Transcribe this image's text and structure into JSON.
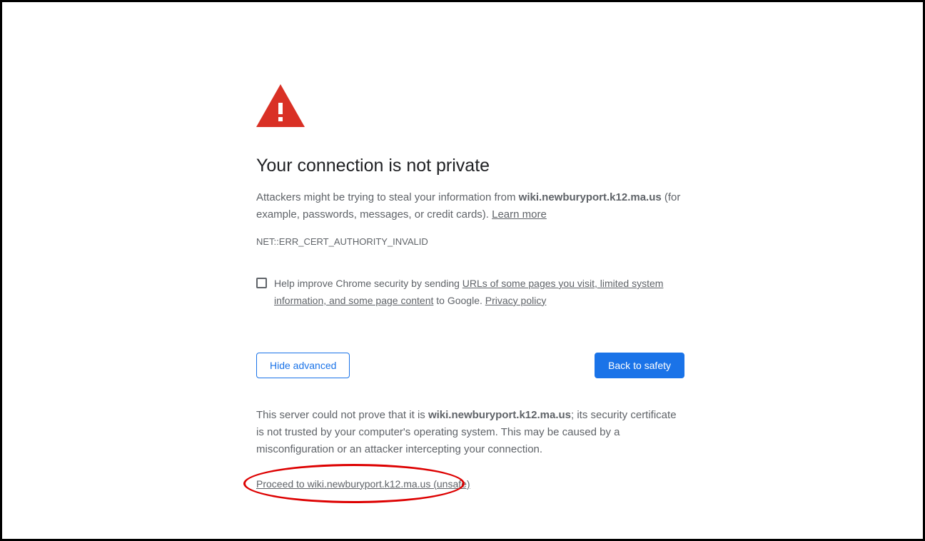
{
  "heading": "Your connection is not private",
  "description": {
    "prefix": "Attackers might be trying to steal your information from ",
    "host": "wiki.newburyport.k12.ma.us",
    "suffix": " (for example, passwords, messages, or credit cards). ",
    "learn_more": "Learn more"
  },
  "error_code": "NET::ERR_CERT_AUTHORITY_INVALID",
  "help": {
    "prefix": "Help improve Chrome security by sending ",
    "link1": "URLs of some pages you visit, limited system information, and some page content",
    "middle": " to Google. ",
    "link2": "Privacy policy"
  },
  "buttons": {
    "advanced": "Hide advanced",
    "back": "Back to safety"
  },
  "details": {
    "prefix": "This server could not prove that it is ",
    "host": "wiki.newburyport.k12.ma.us",
    "suffix": "; its security certificate is not trusted by your computer's operating system. This may be caused by a misconfiguration or an attacker intercepting your connection."
  },
  "proceed_link": "Proceed to wiki.newburyport.k12.ma.us (unsafe)"
}
